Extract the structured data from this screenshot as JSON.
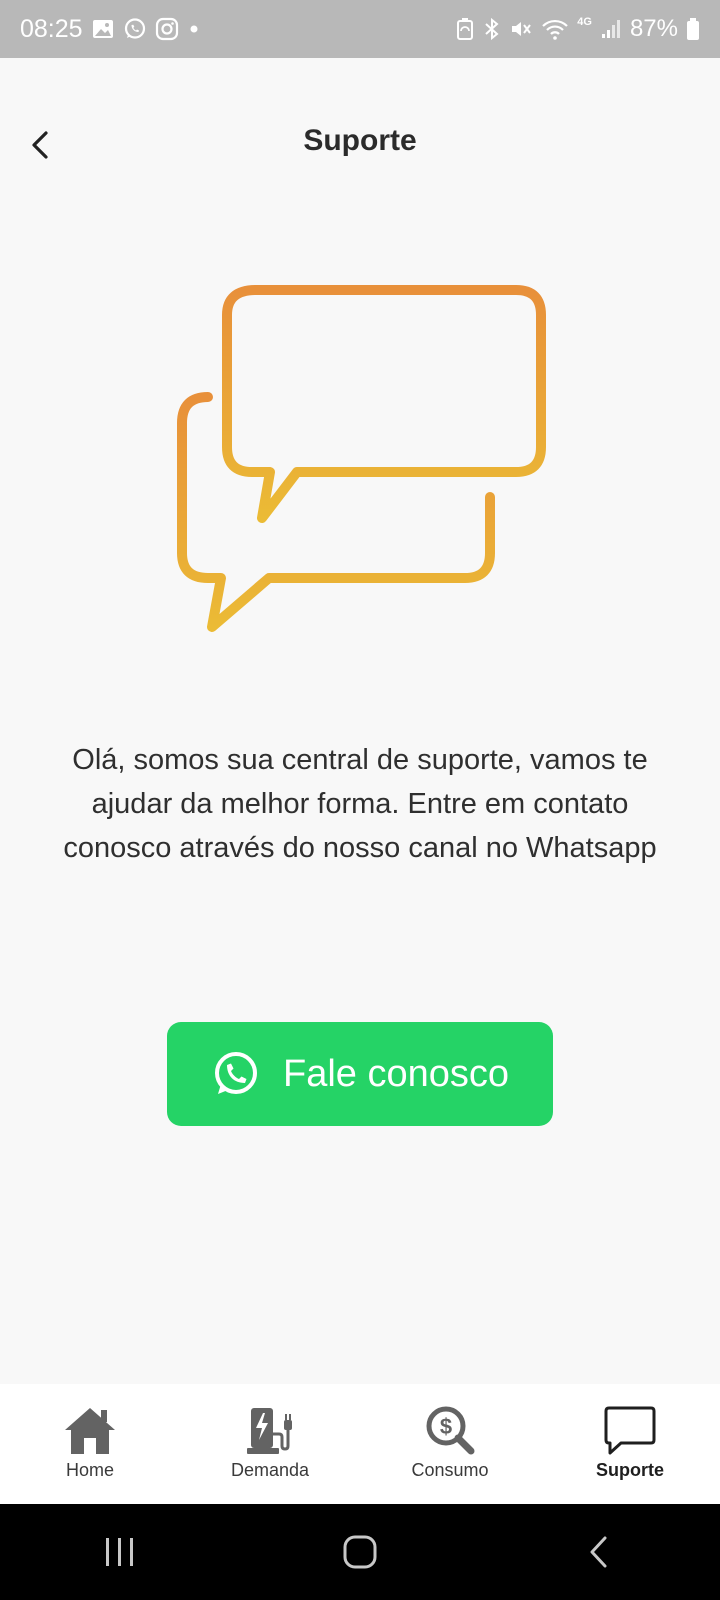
{
  "status_bar": {
    "time": "08:25",
    "network": "4G",
    "battery": "87%"
  },
  "header": {
    "title": "Suporte"
  },
  "content": {
    "message": "Olá, somos sua central de suporte, vamos te ajudar da melhor forma. Entre em contato conosco através do nosso canal no Whatsapp",
    "button_label": "Fale conosco"
  },
  "colors": {
    "background": "#f8f8f8",
    "whatsapp_green": "#25d366",
    "illustration_top": "#e8903a",
    "illustration_bottom": "#ebbb35",
    "nav_icon": "#636363"
  },
  "bottom_nav": {
    "items": [
      {
        "label": "Home",
        "icon": "home-icon"
      },
      {
        "label": "Demanda",
        "icon": "ev-charger-icon"
      },
      {
        "label": "Consumo",
        "icon": "dollar-search-icon"
      },
      {
        "label": "Suporte",
        "icon": "chat-bubble-icon",
        "active": true
      }
    ]
  },
  "icons": {
    "status_left": [
      "gallery-icon",
      "whatsapp-icon",
      "instagram-icon",
      "dot-icon"
    ],
    "status_right": [
      "battery-saver-icon",
      "bluetooth-icon",
      "mute-icon",
      "wifi-icon",
      "signal-icon",
      "battery-icon"
    ],
    "system_nav": [
      "recent-apps-icon",
      "home-circle-icon",
      "back-chevron-icon"
    ]
  }
}
